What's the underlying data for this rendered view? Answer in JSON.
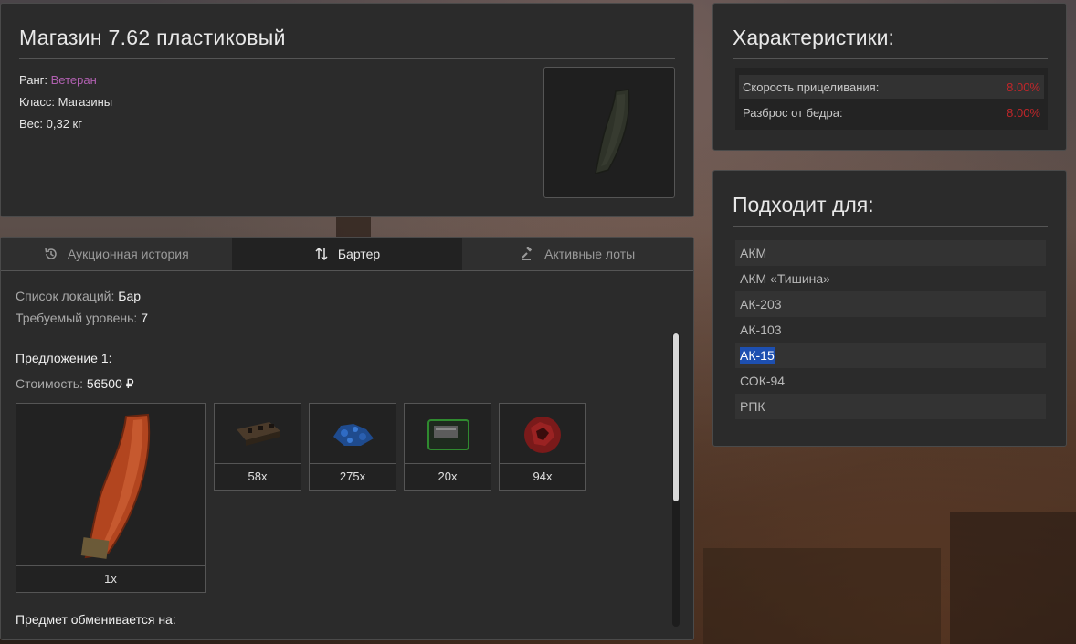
{
  "item": {
    "title": "Магазин 7.62 пластиковый",
    "rank_label": "Ранг:",
    "rank_value": "Ветеран",
    "class_label": "Класс:",
    "class_value": "Магазины",
    "weight_label": "Вес:",
    "weight_value": "0,32 кг",
    "image_icon": "plastic-magazine-icon"
  },
  "tabs": [
    {
      "label": "Аукционная история",
      "icon": "history-icon",
      "active": false
    },
    {
      "label": "Бартер",
      "icon": "swap-arrows-icon",
      "active": true
    },
    {
      "label": "Активные лоты",
      "icon": "gavel-icon",
      "active": false
    }
  ],
  "barter": {
    "locations_label": "Список локаций:",
    "locations_value": "Бар",
    "level_label": "Требуемый уровень:",
    "level_value": "7",
    "offer_title": "Предложение 1:",
    "cost_label": "Стоимость:",
    "cost_value": "56500 ₽",
    "main_slot": {
      "icon": "orange-magazine-icon",
      "qty": "1x"
    },
    "ingredients": [
      {
        "icon": "scrap-metal-icon",
        "qty": "58x"
      },
      {
        "icon": "blue-crystals-icon",
        "qty": "275x"
      },
      {
        "icon": "circuit-board-icon",
        "qty": "20x"
      },
      {
        "icon": "red-artifact-icon",
        "qty": "94x"
      }
    ],
    "exchange_title": "Предмет обменивается на:"
  },
  "stats": {
    "title": "Характеристики:",
    "rows": [
      {
        "name": "Скорость прицеливания:",
        "value": "8.00%"
      },
      {
        "name": "Разброс от бедра:",
        "value": "8.00%"
      }
    ],
    "value_color": "#c0262a"
  },
  "fits": {
    "title": "Подходит для:",
    "items": [
      "АКМ",
      "АКМ «Тишина»",
      "АК-203",
      "АК-103",
      "АК-15",
      "СОК-94",
      "РПК"
    ],
    "selected": "АК-15"
  },
  "colors": {
    "rank": "#b060b0",
    "selection": "#1d4fb0",
    "panel": "#2b2b2b"
  }
}
